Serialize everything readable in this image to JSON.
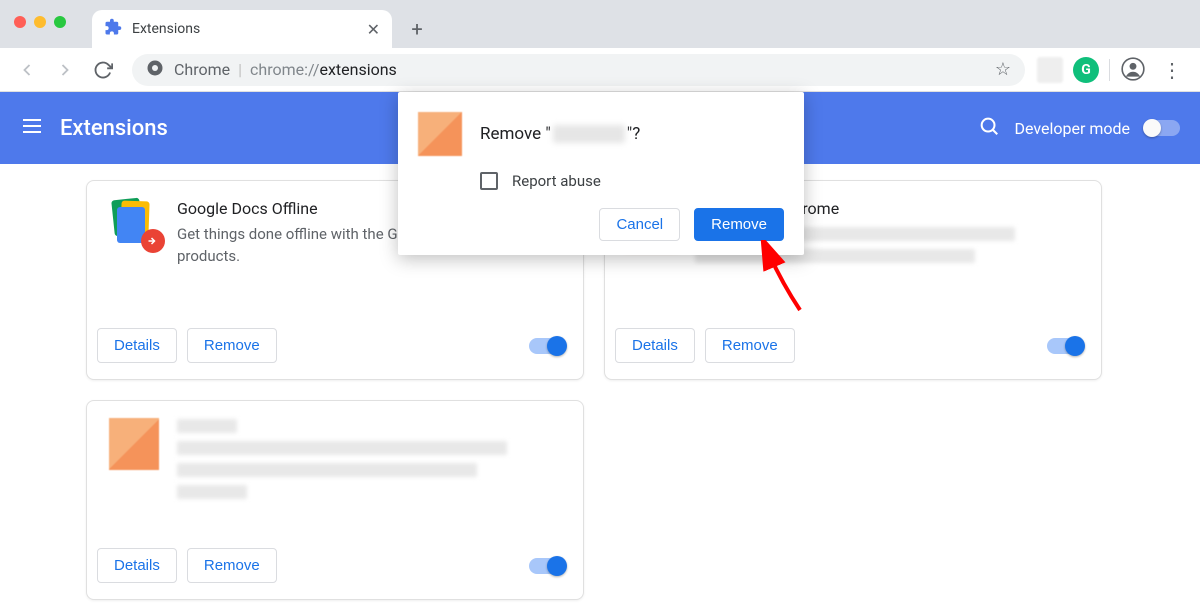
{
  "window": {
    "tab_title": "Extensions",
    "new_tab_glyph": "+"
  },
  "toolbar": {
    "scheme_label": "Chrome",
    "url_prefix": "chrome://",
    "url_path": "extensions",
    "grammarly_badge": "G"
  },
  "header": {
    "title": "Extensions",
    "dev_mode_label": "Developer mode"
  },
  "buttons": {
    "details": "Details",
    "remove": "Remove"
  },
  "extensions": [
    {
      "name": "Google Docs Offline",
      "description": "Get things done offline with the Google Docs family of products."
    },
    {
      "name_suffix": " for Chrome"
    },
    {
      "name": "",
      "description": ""
    }
  ],
  "dialog": {
    "title_prefix": "Remove \"",
    "title_suffix": "\"?",
    "report_abuse": "Report abuse",
    "cancel": "Cancel",
    "remove": "Remove"
  }
}
